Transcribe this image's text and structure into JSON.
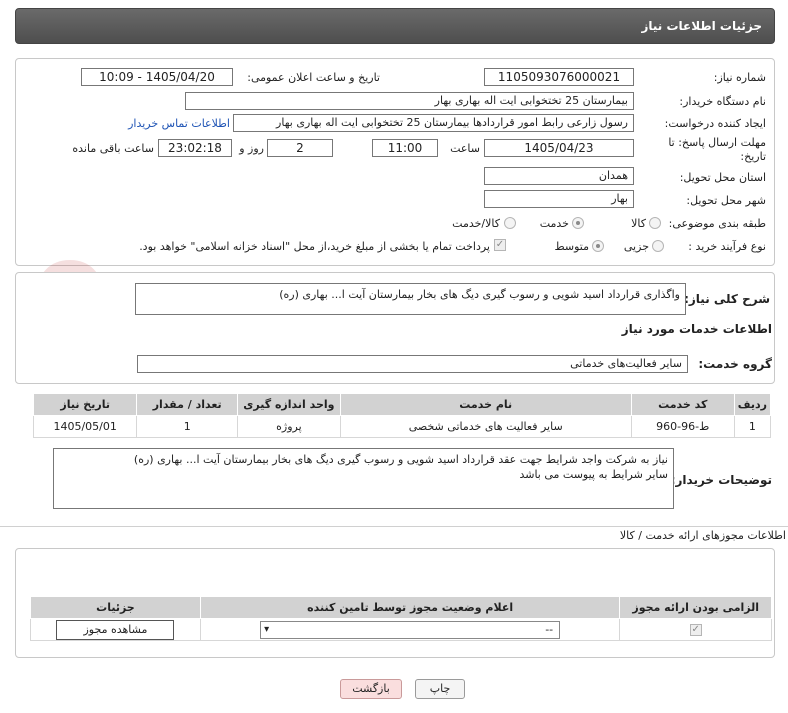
{
  "header": {
    "title": "جزئیات اطلاعات نیاز"
  },
  "form": {
    "need_number": {
      "label": "شماره نیاز:",
      "value": "1105093076000021"
    },
    "announce_datetime": {
      "label": "تاریخ و ساعت اعلان عمومی:",
      "value": "1405/04/20 - 10:09"
    },
    "buyer_org": {
      "label": "نام دستگاه خریدار:",
      "value": "بیمارستان 25 تختخوابی ایت اله بهاری بهار"
    },
    "creator": {
      "label": "ایجاد کننده درخواست:",
      "value": "رسول زارعی رابط امور قراردادها بیمارستان 25 تختخوابی ایت اله بهاری بهار",
      "contact_link": "اطلاعات تماس خریدار"
    },
    "deadline": {
      "label": "مهلت ارسال پاسخ: تا تاریخ:",
      "date": "1405/04/23",
      "time_label": "ساعت",
      "time": "11:00",
      "days": "2",
      "days_label": "روز و",
      "remaining": "23:02:18",
      "remaining_label": "ساعت باقی مانده"
    },
    "province": {
      "label": "استان محل تحویل:",
      "value": "همدان"
    },
    "city": {
      "label": "شهر محل تحویل:",
      "value": "بهار"
    },
    "category": {
      "label": "طبقه بندی موضوعی:",
      "options": [
        "کالا",
        "خدمت",
        "کالا/خدمت"
      ],
      "selected": "خدمت"
    },
    "purchase_type": {
      "label": "نوع فرآیند خرید :",
      "options": [
        "جزیی",
        "متوسط"
      ],
      "selected": "متوسط",
      "payment_note": "پرداخت تمام یا بخشی از مبلغ خرید،از محل \"اسناد خزانه اسلامی\" خواهد بود."
    }
  },
  "description": {
    "label": "شرح کلی نیاز:",
    "value": "واگذاری قرارداد اسید شویی و رسوب گیری دیگ های بخار بیمارستان آیت ا... بهاری (ره)"
  },
  "services": {
    "section_title": "اطلاعات خدمات مورد نیاز",
    "group_label": "گروه خدمت:",
    "group_value": "سایر فعالیت‌های خدماتی",
    "columns": [
      "ردیف",
      "کد خدمت",
      "نام خدمت",
      "واحد اندازه گیری",
      "تعداد / مقدار",
      "تاریخ نیاز"
    ],
    "rows": [
      [
        "1",
        "ط-96-960",
        "سایر فعالیت های خدماتی شخصی",
        "پروژه",
        "1",
        "1405/05/01"
      ]
    ]
  },
  "buyer_notes": {
    "label": "توضیحات خریدار:",
    "lines": [
      "نیاز به شرکت واجد شرایط جهت عقد قرارداد اسید شویی و رسوب گیری دیگ های بخار بیمارستان آیت ا... بهاری (ره)",
      "سایر شرایط به پیوست می باشد"
    ]
  },
  "permits": {
    "section_title": "اطلاعات مجوزهای ارائه خدمت / کالا",
    "columns": [
      "الزامی بودن ارائه مجوز",
      "اعلام وضعیت مجوز توسط تامین کننده",
      "جزئیات"
    ],
    "select_value": "--",
    "view_button": "مشاهده مجوز"
  },
  "actions": {
    "print": "چاپ",
    "back": "بازگشت"
  },
  "watermark": "AriaTender.neT",
  "colors": {
    "header": "#555555",
    "link": "#1f54b5",
    "back_button": "#fadede"
  }
}
